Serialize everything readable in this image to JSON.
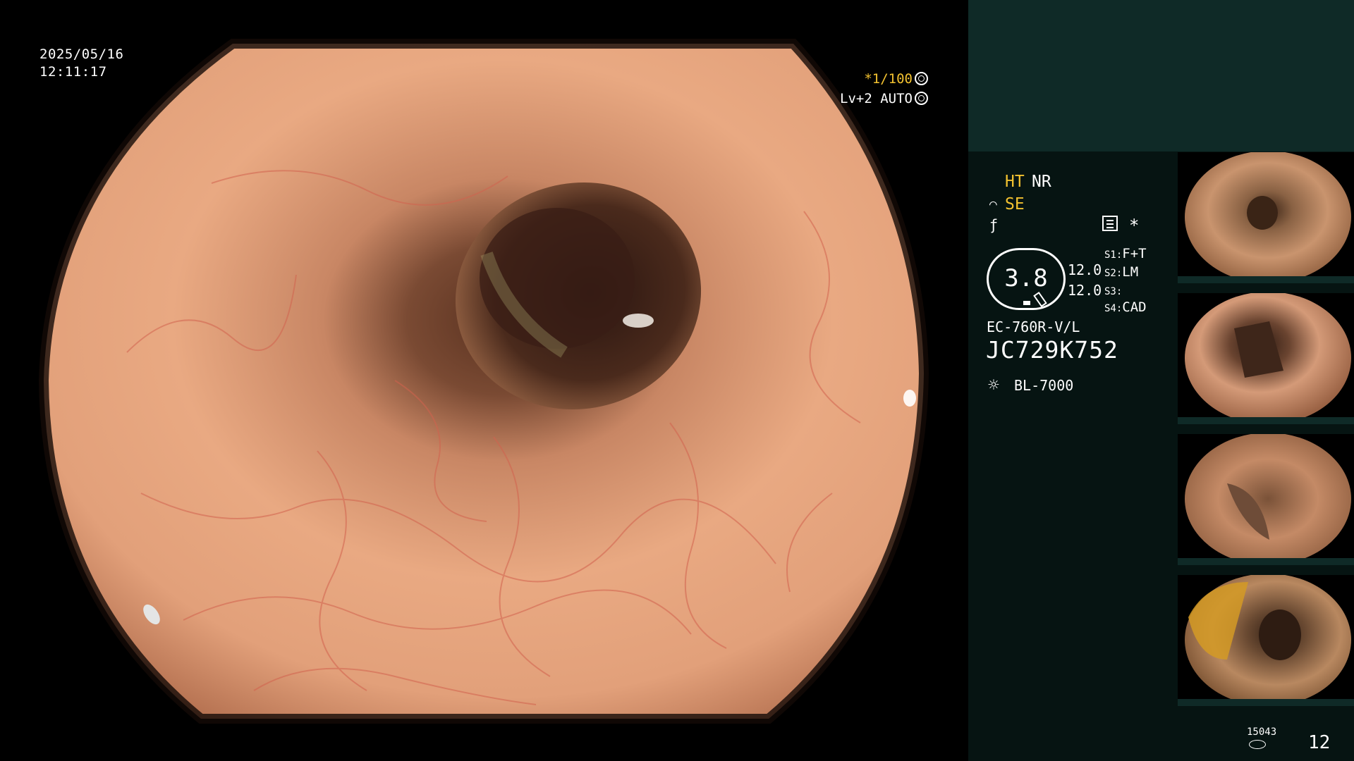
{
  "main": {
    "timestamp": {
      "date": "2025/05/16",
      "time": "12:11:17"
    },
    "shutter": {
      "prefix": "*",
      "value": "1/100",
      "icon": "shutter-icon"
    },
    "iris": {
      "level": "Lv+2",
      "mode": "AUTO",
      "icon": "iris-icon"
    },
    "image_description_icon": "endoscope-view"
  },
  "panel": {
    "ht": "HT",
    "nr": "NR",
    "se": "SE",
    "se_icon": "curve-icon",
    "f_icon": "f-curve-icon",
    "menu_icon": "menu-icon",
    "asterisk": "*",
    "zoom": "3.8",
    "value_1": "12.0",
    "value_2": "12.0",
    "switches": [
      {
        "key": "S1",
        "value": "F+T"
      },
      {
        "key": "S2",
        "value": "LM"
      },
      {
        "key": "S3",
        "value": ""
      },
      {
        "key": "S4",
        "value": "CAD"
      }
    ],
    "scope_model": "EC-760R-V/L",
    "scope_serial": "JC729K752",
    "light_icon": "light-source-icon",
    "light_model": "BL-7000",
    "counter_small": "15043",
    "page_number": "12"
  },
  "colors": {
    "panel_bg": "#061412",
    "panel_header": "#0f2a27",
    "highlight": "#f3c230"
  }
}
